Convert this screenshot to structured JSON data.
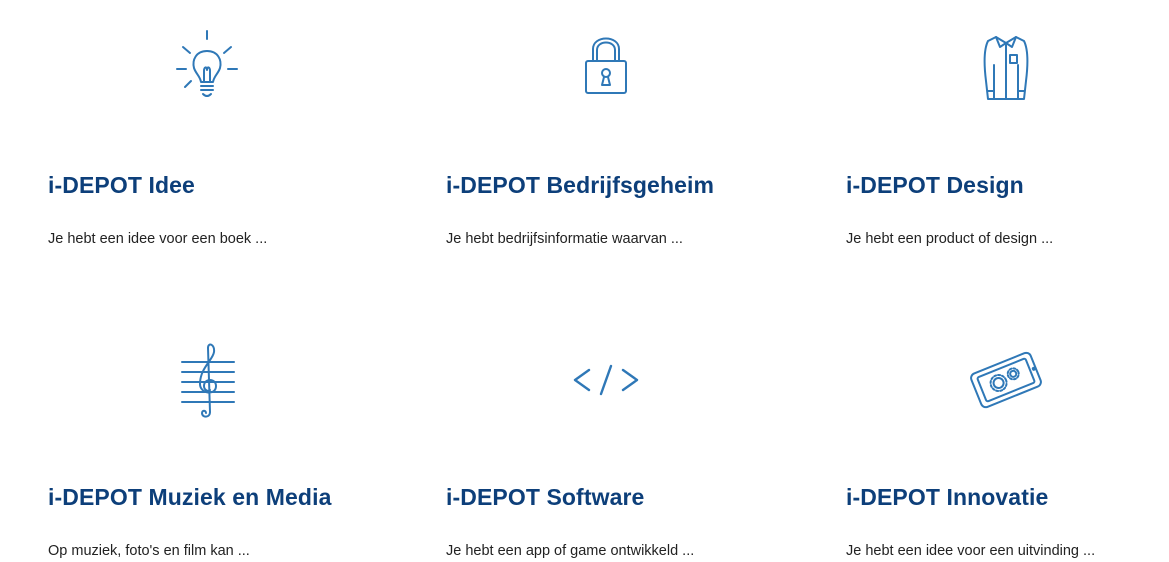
{
  "cards": [
    {
      "title": "i-DEPOT Idee",
      "description": "Je hebt een idee voor een boek ...",
      "icon": "lightbulb-icon"
    },
    {
      "title": "i-DEPOT Bedrijfsgeheim",
      "description": "Je hebt bedrijfsinformatie waarvan ...",
      "icon": "padlock-icon"
    },
    {
      "title": "i-DEPOT Design",
      "description": "Je hebt een product of design ...",
      "icon": "shirt-icon"
    },
    {
      "title": "i-DEPOT Muziek en Media",
      "description": "Op muziek, foto's en film kan ...",
      "icon": "treble-clef-icon"
    },
    {
      "title": "i-DEPOT Software",
      "description": "Je hebt een app of game ontwikkeld ...",
      "icon": "code-tag-icon"
    },
    {
      "title": "i-DEPOT Innovatie",
      "description": "Je hebt een idee voor een uitvinding ...",
      "icon": "tablet-gears-icon"
    }
  ],
  "colors": {
    "title": "#0d3f7a",
    "icon_stroke": "#2f78b7",
    "text": "#222222",
    "background": "#ffffff"
  }
}
